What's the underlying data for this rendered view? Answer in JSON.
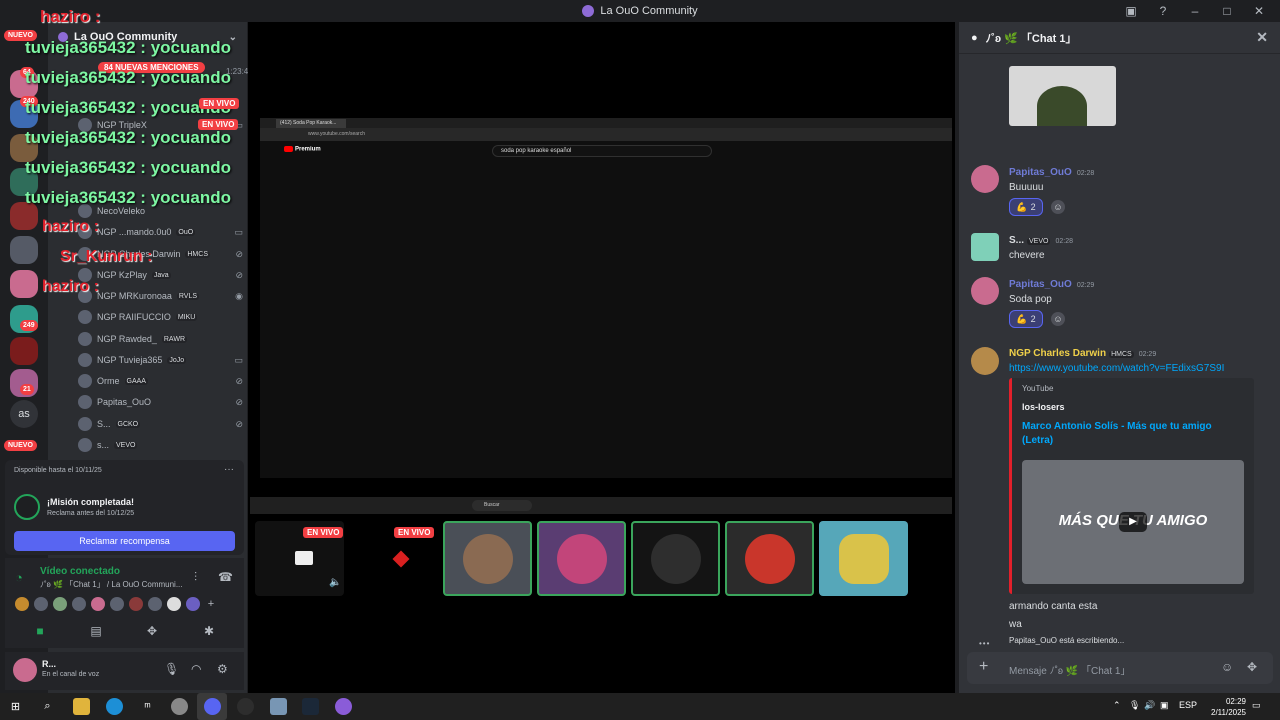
{
  "window": {
    "title": "La OuO Community"
  },
  "rail": {
    "badges": [
      "64",
      "240",
      "249",
      "21"
    ],
    "nuevo_label": "NUEVO",
    "text_server": "as"
  },
  "sidebar": {
    "server_name": "La OuO Community",
    "mentions_pill": "84 NUEVAS MENCIONES",
    "time_label": "1:23:48",
    "voice_users": [
      {
        "name": "NGP TripleX",
        "tag": "",
        "live": "EN VIVO"
      },
      {
        "name": "NecoVeleko",
        "tag": ""
      },
      {
        "name": "NGP ...mando.0u0",
        "tag": "OuO"
      },
      {
        "name": "NGP Charles Darwin",
        "tag": "HMCS"
      },
      {
        "name": "NGP KzPlay",
        "tag": "Java"
      },
      {
        "name": "NGP MRKuronoaa",
        "tag": "RVLS"
      },
      {
        "name": "NGP RAIIFUCCIO",
        "tag": "MIKU"
      },
      {
        "name": "NGP Rawded_",
        "tag": "RAWR"
      },
      {
        "name": "NGP Tuvieja365",
        "tag": "JoJo"
      },
      {
        "name": "Orme",
        "tag": "GAAA"
      },
      {
        "name": "Papitas_OuO",
        "tag": ""
      },
      {
        "name": "S...",
        "tag": "GCKO"
      },
      {
        "name": "s...",
        "tag": "VEVO"
      }
    ],
    "live_label": "EN VIVO",
    "mission": {
      "available": "Disponible hasta el 10/11/25",
      "title": "¡Misión completada!",
      "subtitle": "Reclama antes del 10/12/25",
      "button": "Reclamar recompensa"
    },
    "voice": {
      "status": "Vídeo conectado",
      "channel": "ﾉ˚ʚ 🌿 「Chat 1」 / La OuO Communi..."
    },
    "user": {
      "name": "R...",
      "status": "En el canal de voz"
    }
  },
  "overlay": {
    "top_user": "haziro :",
    "lines": [
      "tuvieja365432 : yocuando",
      "tuvieja365432 : yocuando",
      "tuvieja365432 : yocuando",
      "tuvieja365432 : yocuando",
      "tuvieja365432 : yocuando",
      "tuvieja365432 : yocuando"
    ],
    "red_lines": [
      "haziro :",
      "Sr_Kunrun :",
      "haziro :"
    ]
  },
  "stage": {
    "tab_title": "(412) Soda Pop Karaok...",
    "url": "www.youtube.com/search",
    "yt_brand": "Premium",
    "search_query": "soda pop karaoke español",
    "taskbar_search": "Buscar",
    "tiles_live_label": "EN VIVO"
  },
  "chat": {
    "channel": "ﾉ˚ʚ 🌿 「Chat 1」",
    "messages": [
      {
        "author": "Papitas_OuO",
        "time": "02:28",
        "text": "Buuuuu",
        "reaction_count": "2"
      },
      {
        "author": "S...",
        "tag": "VEVO",
        "time": "02:28",
        "text": "chevere"
      },
      {
        "author": "Papitas_OuO",
        "time": "02:29",
        "text": "Soda pop",
        "reaction_count": "2"
      },
      {
        "author": "NGP Charles Darwin",
        "tag": "HMCS",
        "time": "02:29",
        "text": "https://www.youtube.com/watch?v=FEdixsG7S9I"
      }
    ],
    "embed": {
      "provider": "YouTube",
      "author": "los-losers",
      "title": "Marco Antonio Solís - Más que tu amigo (Letra)",
      "thumb_text": "MÁS QUE TU AMIGO"
    },
    "after_lines": [
      "armando canta esta",
      "wa"
    ],
    "typing": "Papitas_OuO está escribiendo...",
    "composer_placeholder": "Mensaje ﾉ˚ʚ 🌿 「Chat 1」"
  },
  "taskbar": {
    "lang": "ESP",
    "time": "02:29",
    "date": "2/11/2025"
  },
  "colors": {
    "accent": "#5865f2",
    "online": "#23a55a",
    "danger": "#f23f43",
    "link": "#00a8fc",
    "overlay_green": "#7ef7a3"
  }
}
